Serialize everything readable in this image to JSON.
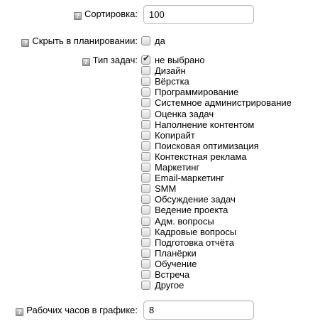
{
  "sort": {
    "label": "Сортировка:",
    "value": "100"
  },
  "hide_in_planning": {
    "label": "Скрыть в планировании:",
    "option_label": "да",
    "checked": false
  },
  "task_type": {
    "label": "Тип задач:",
    "options": [
      {
        "label": "не выбрано",
        "checked": true
      },
      {
        "label": "Дизайн",
        "checked": false
      },
      {
        "label": "Вёрстка",
        "checked": false
      },
      {
        "label": "Программирование",
        "checked": false
      },
      {
        "label": "Системное администрирование",
        "checked": false
      },
      {
        "label": "Оценка задач",
        "checked": false
      },
      {
        "label": "Наполнение контентом",
        "checked": false
      },
      {
        "label": "Копирайт",
        "checked": false
      },
      {
        "label": "Поисковая оптимизация",
        "checked": false
      },
      {
        "label": "Контекстная реклама",
        "checked": false
      },
      {
        "label": "Маркетинг",
        "checked": false
      },
      {
        "label": "Email-маркетинг",
        "checked": false
      },
      {
        "label": "SMM",
        "checked": false
      },
      {
        "label": "Обсуждение задач",
        "checked": false
      },
      {
        "label": "Ведение проекта",
        "checked": false
      },
      {
        "label": "Адм. вопросы",
        "checked": false
      },
      {
        "label": "Кадровые вопросы",
        "checked": false
      },
      {
        "label": "Подготовка отчёта",
        "checked": false
      },
      {
        "label": "Планёрки",
        "checked": false
      },
      {
        "label": "Обучение",
        "checked": false
      },
      {
        "label": "Встреча",
        "checked": false
      },
      {
        "label": "Другое",
        "checked": false
      }
    ]
  },
  "work_hours": {
    "label": "Рабочих часов в графике:",
    "value": "8"
  },
  "icons": {
    "help_icon": "help-icon",
    "check_icon": "checkmark-icon"
  }
}
